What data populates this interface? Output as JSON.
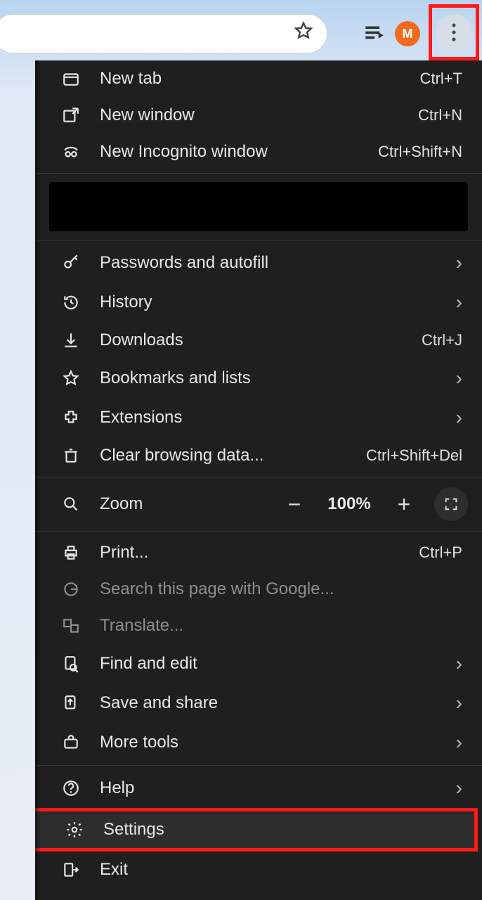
{
  "toolbar": {
    "avatar_initial": "M"
  },
  "menu": {
    "new_tab": {
      "label": "New tab",
      "shortcut": "Ctrl+T"
    },
    "new_window": {
      "label": "New window",
      "shortcut": "Ctrl+N"
    },
    "incognito": {
      "label": "New Incognito window",
      "shortcut": "Ctrl+Shift+N"
    },
    "passwords": {
      "label": "Passwords and autofill"
    },
    "history": {
      "label": "History"
    },
    "downloads": {
      "label": "Downloads",
      "shortcut": "Ctrl+J"
    },
    "bookmarks": {
      "label": "Bookmarks and lists"
    },
    "extensions": {
      "label": "Extensions"
    },
    "clear_data": {
      "label": "Clear browsing data...",
      "shortcut": "Ctrl+Shift+Del"
    },
    "zoom": {
      "label": "Zoom",
      "value": "100%"
    },
    "print": {
      "label": "Print...",
      "shortcut": "Ctrl+P"
    },
    "search_page": {
      "label": "Search this page with Google..."
    },
    "translate": {
      "label": "Translate..."
    },
    "find_edit": {
      "label": "Find and edit"
    },
    "save_share": {
      "label": "Save and share"
    },
    "more_tools": {
      "label": "More tools"
    },
    "help": {
      "label": "Help"
    },
    "settings": {
      "label": "Settings"
    },
    "exit": {
      "label": "Exit"
    }
  }
}
